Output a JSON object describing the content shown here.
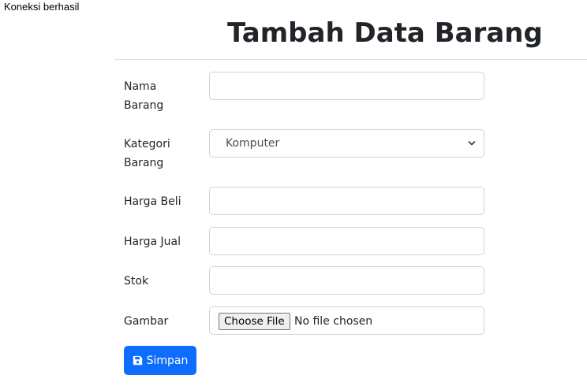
{
  "status_message": "Koneksi berhasil",
  "page_title": "Tambah Data Barang",
  "form": {
    "nama_barang": {
      "label_line1": "Nama",
      "label_line2": "Barang",
      "value": ""
    },
    "kategori_barang": {
      "label_line1": "Kategori",
      "label_line2": "Barang",
      "selected": "Komputer",
      "icon": "chevron-down-icon"
    },
    "harga_beli": {
      "label": "Harga Beli",
      "value": ""
    },
    "harga_jual": {
      "label": "Harga Jual",
      "value": ""
    },
    "stok": {
      "label": "Stok",
      "value": ""
    },
    "gambar": {
      "label": "Gambar",
      "button_label": "Choose File",
      "file_status": "No file chosen"
    },
    "submit": {
      "label": "Simpan",
      "icon": "save-icon"
    }
  },
  "colors": {
    "primary": "#0d6efd",
    "border": "#ced4da",
    "text": "#212529"
  }
}
